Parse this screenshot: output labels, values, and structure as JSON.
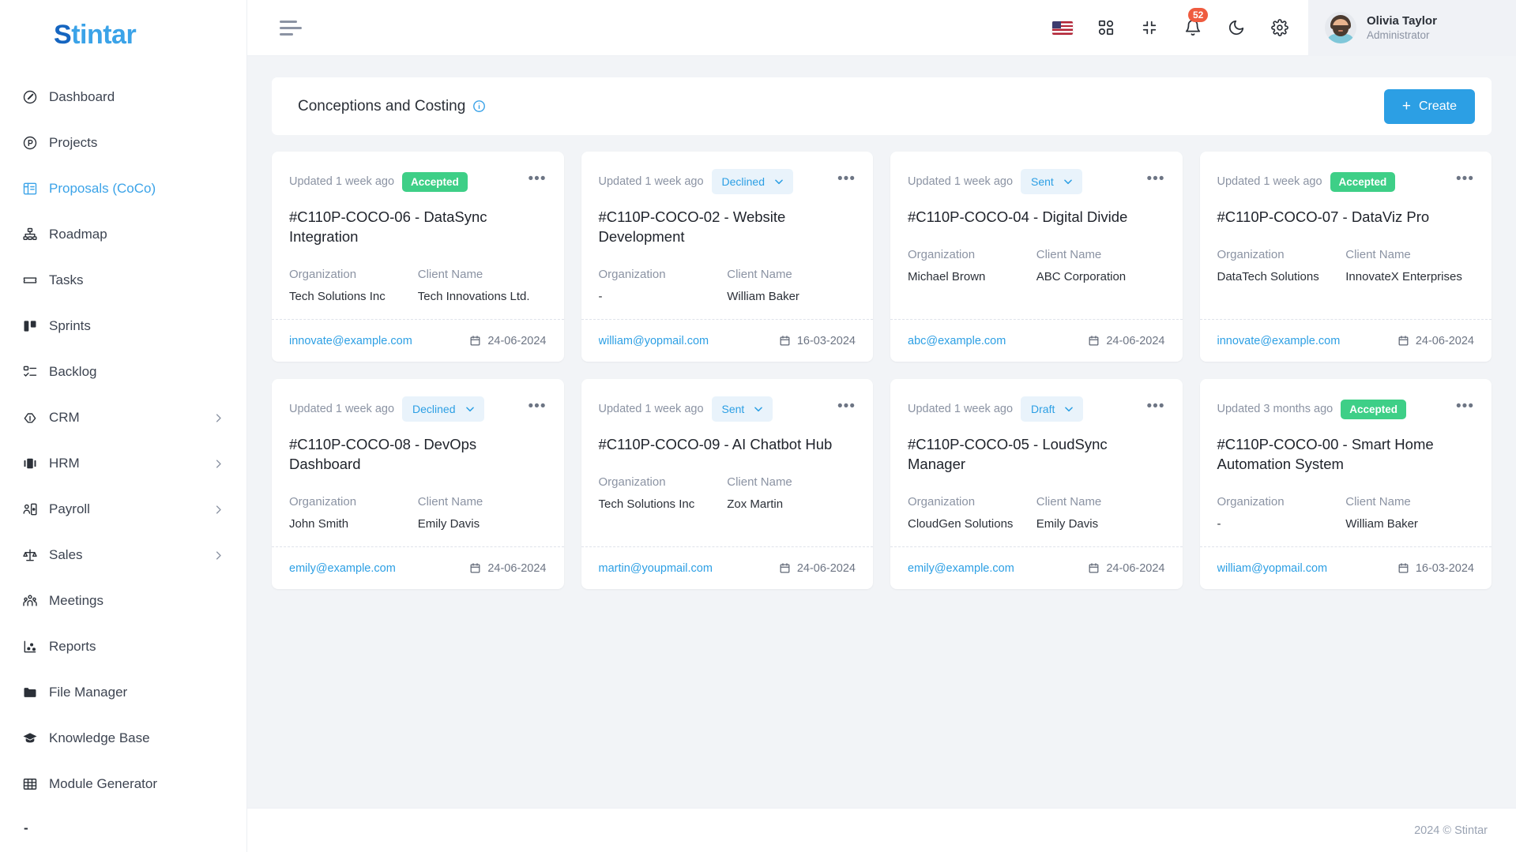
{
  "brand": {
    "name": "Stintar",
    "accent": "#2c9fe4"
  },
  "sidebar": {
    "items": [
      {
        "label": "Dashboard",
        "icon": "gauge-icon",
        "has_chevron": false,
        "active": false
      },
      {
        "label": "Projects",
        "icon": "project-circle-icon",
        "has_chevron": false,
        "active": false
      },
      {
        "label": "Proposals (CoCo)",
        "icon": "proposal-layout-icon",
        "has_chevron": false,
        "active": true
      },
      {
        "label": "Roadmap",
        "icon": "hierarchy-icon",
        "has_chevron": false,
        "active": false
      },
      {
        "label": "Tasks",
        "icon": "ticket-icon",
        "has_chevron": false,
        "active": false
      },
      {
        "label": "Sprints",
        "icon": "kanban-icon",
        "has_chevron": false,
        "active": false
      },
      {
        "label": "Backlog",
        "icon": "checklist-icon",
        "has_chevron": false,
        "active": false
      },
      {
        "label": "CRM",
        "icon": "handshake-icon",
        "has_chevron": true,
        "active": false
      },
      {
        "label": "HRM",
        "icon": "people-card-icon",
        "has_chevron": true,
        "active": false
      },
      {
        "label": "Payroll",
        "icon": "person-badge-icon",
        "has_chevron": true,
        "active": false
      },
      {
        "label": "Sales",
        "icon": "scales-icon",
        "has_chevron": true,
        "active": false
      },
      {
        "label": "Meetings",
        "icon": "group-people-icon",
        "has_chevron": false,
        "active": false
      },
      {
        "label": "Reports",
        "icon": "scatter-chart-icon",
        "has_chevron": false,
        "active": false
      },
      {
        "label": "File Manager",
        "icon": "folder-icon",
        "has_chevron": false,
        "active": false
      },
      {
        "label": "Knowledge Base",
        "icon": "graduation-cap-icon",
        "has_chevron": false,
        "active": false
      },
      {
        "label": "Module Generator",
        "icon": "grid-table-icon",
        "has_chevron": false,
        "active": false
      }
    ],
    "tail_label": "-"
  },
  "topbar": {
    "menu_toggle_icon": "hamburger-icon",
    "icons": [
      {
        "name": "flag-us-icon"
      },
      {
        "name": "apps-grid-icon"
      },
      {
        "name": "compress-icon"
      },
      {
        "name": "bell-icon",
        "badge": "52"
      },
      {
        "name": "moon-icon"
      },
      {
        "name": "gear-icon"
      }
    ],
    "notification_count": "52",
    "user": {
      "name": "Olivia Taylor",
      "role": "Administrator"
    }
  },
  "panel": {
    "title": "Conceptions and Costing",
    "info_icon": "info-circle-icon",
    "create_label": "Create",
    "create_plus": "+"
  },
  "card_labels": {
    "organization": "Organization",
    "client_name": "Client Name",
    "more_icon": "more-options-icon",
    "calendar_icon": "calendar-icon",
    "chevron_icon": "chevron-down-icon"
  },
  "status_colors": {
    "accepted_bg": "#3ecf87",
    "accepted_text": "#ffffff",
    "select_bg": "#e9f3fb",
    "select_text": "#2c9fe4"
  },
  "cards": [
    {
      "updated": "Updated 1 week ago",
      "status": "Accepted",
      "status_type": "static",
      "title": "#C110P-COCO-06 - DataSync Integration",
      "organization": "Tech Solutions Inc",
      "client": "Tech Innovations Ltd.",
      "email": "innovate@example.com",
      "date": "24-06-2024"
    },
    {
      "updated": "Updated 1 week ago",
      "status": "Declined",
      "status_type": "select",
      "title": "#C110P-COCO-02 - Website Development",
      "organization": "-",
      "client": "William Baker",
      "email": "william@yopmail.com",
      "date": "16-03-2024"
    },
    {
      "updated": "Updated 1 week ago",
      "status": "Sent",
      "status_type": "select",
      "title": "#C110P-COCO-04 - Digital Divide",
      "organization": "Michael Brown",
      "client": "ABC Corporation",
      "email": "abc@example.com",
      "date": "24-06-2024"
    },
    {
      "updated": "Updated 1 week ago",
      "status": "Accepted",
      "status_type": "static",
      "title": "#C110P-COCO-07 - DataViz Pro",
      "organization": "DataTech Solutions",
      "client": "InnovateX Enterprises",
      "email": "innovate@example.com",
      "date": "24-06-2024"
    },
    {
      "updated": "Updated 1 week ago",
      "status": "Declined",
      "status_type": "select",
      "title": "#C110P-COCO-08 - DevOps Dashboard",
      "organization": "John Smith",
      "client": "Emily Davis",
      "email": "emily@example.com",
      "date": "24-06-2024"
    },
    {
      "updated": "Updated 1 week ago",
      "status": "Sent",
      "status_type": "select",
      "title": "#C110P-COCO-09 - AI Chatbot Hub",
      "organization": "Tech Solutions Inc",
      "client": "Zox Martin",
      "email": "martin@youpmail.com",
      "date": "24-06-2024"
    },
    {
      "updated": "Updated 1 week ago",
      "status": "Draft",
      "status_type": "select",
      "title": "#C110P-COCO-05 - LoudSync Manager",
      "organization": "CloudGen Solutions",
      "client": "Emily Davis",
      "email": "emily@example.com",
      "date": "24-06-2024"
    },
    {
      "updated": "Updated 3 months ago",
      "status": "Accepted",
      "status_type": "static",
      "title": "#C110P-COCO-00 - Smart Home Automation System",
      "organization": "-",
      "client": "William Baker",
      "email": "william@yopmail.com",
      "date": "16-03-2024"
    }
  ],
  "footer": {
    "copyright": "2024 © Stintar"
  }
}
